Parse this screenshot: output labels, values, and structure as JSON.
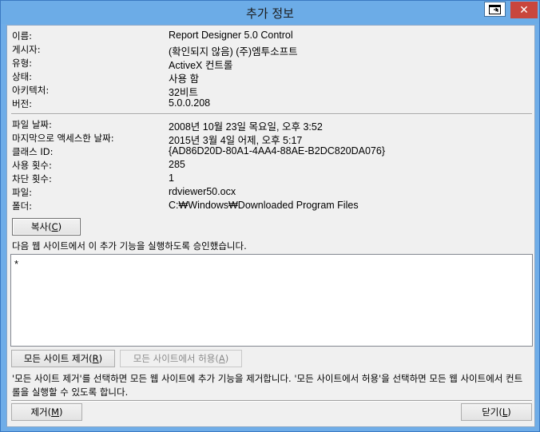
{
  "window": {
    "title": "추가 정보",
    "close_glyph": "✕",
    "help_icon": "window-icon"
  },
  "info_group1": [
    {
      "label": "이름:",
      "value": "Report Designer 5.0 Control"
    },
    {
      "label": "게시자:",
      "value": "(확인되지 않음) (주)엠투소프트"
    },
    {
      "label": "유형:",
      "value": "ActiveX 컨트롤"
    },
    {
      "label": "상태:",
      "value": "사용 함"
    },
    {
      "label": "아키텍처:",
      "value": "32비트"
    },
    {
      "label": "버전:",
      "value": "5.0.0.208"
    }
  ],
  "info_group2": [
    {
      "label": "파일 날짜:",
      "value": "2008년 10월 23일 목요일, 오후 3:52"
    },
    {
      "label": "마지막으로 액세스한 날짜:",
      "value": "2015년 3월 4일 어제, 오후 5:17"
    },
    {
      "label": "클래스 ID:",
      "value": "{AD86D20D-80A1-4AA4-88AE-B2DC820DA076}"
    },
    {
      "label": "사용 횟수:",
      "value": "285"
    },
    {
      "label": "차단 횟수:",
      "value": "1"
    },
    {
      "label": "파일:",
      "value": "rdviewer50.ocx"
    },
    {
      "label": "폴더:",
      "value": "C:₩Windows₩Downloaded Program Files"
    }
  ],
  "buttons": {
    "copy": {
      "text": "복사(",
      "key": "C",
      "end": ")"
    },
    "remove_all": {
      "text": "모든 사이트 제거(",
      "key": "R",
      "end": ")"
    },
    "allow_all": {
      "text": "모든 사이트에서 허용(",
      "key": "A",
      "end": ")"
    },
    "remove": {
      "text": "제거(",
      "key": "M",
      "end": ")"
    },
    "close": {
      "text": "닫기(",
      "key": "L",
      "end": ")"
    }
  },
  "sites": {
    "heading": "다음 웹 사이트에서 이 추가 기능을 실행하도록 승인했습니다.",
    "items": [
      "*"
    ]
  },
  "note": "'모든 사이트 제거'를 선택하면 모든 웹 사이트에 추가 기능을 제거합니다. '모든 사이트에서 허용'을 선택하면 모든 웹 사이트에서 컨트롤을 실행할 수 있도록 합니다."
}
